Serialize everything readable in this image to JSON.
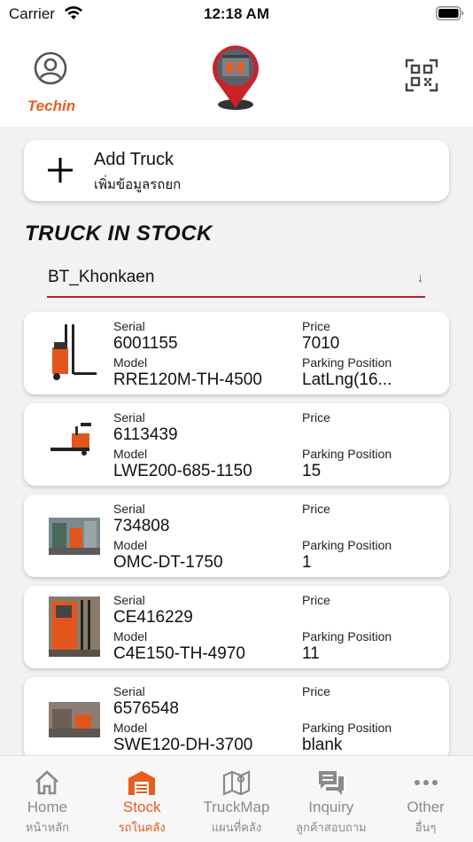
{
  "status_bar": {
    "carrier": "Carrier",
    "time": "12:18 AM"
  },
  "header": {
    "profile_label": "Techin"
  },
  "add_truck": {
    "title": "Add Truck",
    "subtitle": "เพิ่มข้อมูลรถยก"
  },
  "section_title": "TRUCK IN STOCK",
  "branch_select": {
    "value": "BT_Khonkaen"
  },
  "labels": {
    "serial": "Serial",
    "model": "Model",
    "price": "Price",
    "parking": "Parking Position"
  },
  "trucks": [
    {
      "serial": "6001155",
      "model": "RRE120M-TH-4500",
      "price": "7010",
      "parking": "LatLng(16..."
    },
    {
      "serial": "6113439",
      "model": "LWE200-685-1150",
      "price": "",
      "parking": "15"
    },
    {
      "serial": "734808",
      "model": "OMC-DT-1750",
      "price": "",
      "parking": "1"
    },
    {
      "serial": "CE416229",
      "model": "C4E150-TH-4970",
      "price": "",
      "parking": "11"
    },
    {
      "serial": "6576548",
      "model": "SWE120-DH-3700",
      "price": "",
      "parking": "blank"
    }
  ],
  "tabs": [
    {
      "label": "Home",
      "sub": "หน้าหลัก",
      "icon": "home-icon"
    },
    {
      "label": "Stock",
      "sub": "รถในคลัง",
      "icon": "warehouse-icon"
    },
    {
      "label": "TruckMap",
      "sub": "แผนที่คลัง",
      "icon": "map-icon"
    },
    {
      "label": "Inquiry",
      "sub": "ลูกค้าสอบถาม",
      "icon": "chat-icon"
    },
    {
      "label": "Other",
      "sub": "อื่นๆ",
      "icon": "more-icon"
    }
  ],
  "colors": {
    "accent": "#e85d1e",
    "underline": "#a9252c",
    "inactive": "#8a8a8a"
  }
}
